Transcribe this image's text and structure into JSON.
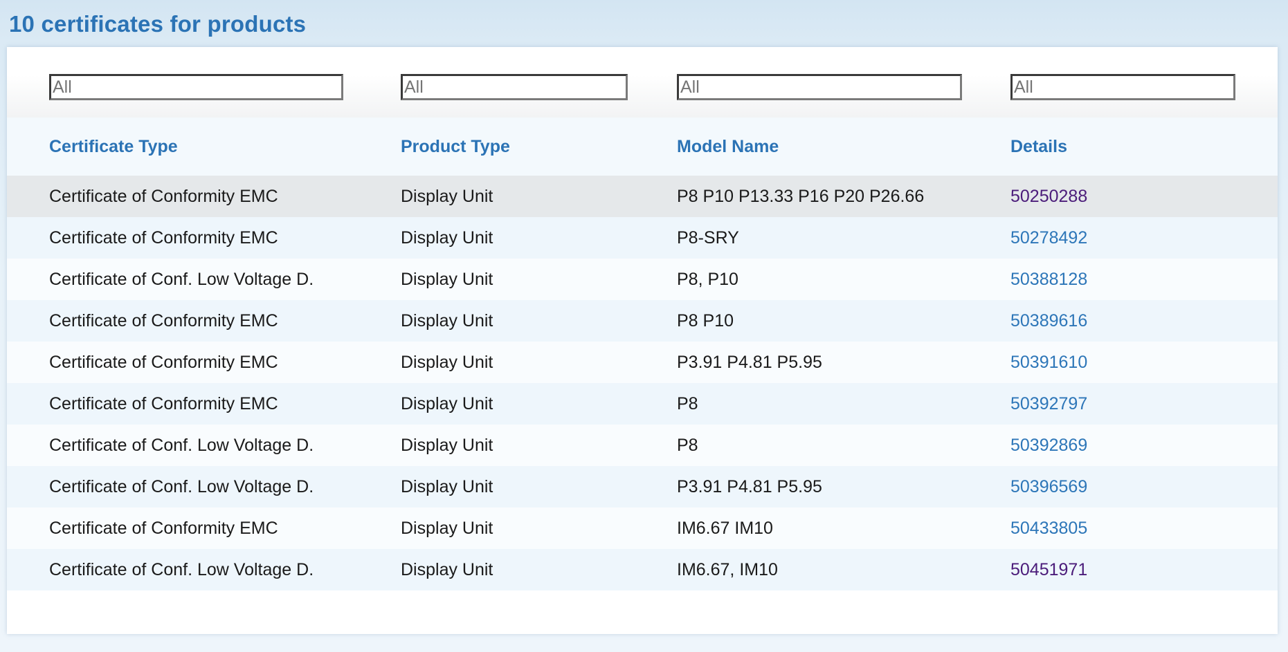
{
  "page": {
    "title": "10 certificates for products"
  },
  "filters": [
    {
      "placeholder": "All",
      "value": ""
    },
    {
      "placeholder": "All",
      "value": ""
    },
    {
      "placeholder": "All",
      "value": ""
    },
    {
      "placeholder": "All",
      "value": ""
    }
  ],
  "table": {
    "headers": [
      "Certificate Type",
      "Product Type",
      "Model Name",
      "Details"
    ],
    "rows": [
      {
        "certificate_type": "Certificate of Conformity EMC",
        "product_type": "Display Unit",
        "model_name": "P8 P10 P13.33 P16 P20 P26.66",
        "details": "50250288",
        "visited": true
      },
      {
        "certificate_type": "Certificate of Conformity EMC",
        "product_type": "Display Unit",
        "model_name": "P8-SRY",
        "details": "50278492",
        "visited": false
      },
      {
        "certificate_type": "Certificate of Conf. Low Voltage D.",
        "product_type": "Display Unit",
        "model_name": "P8, P10",
        "details": "50388128",
        "visited": false
      },
      {
        "certificate_type": "Certificate of Conformity EMC",
        "product_type": "Display Unit",
        "model_name": "P8 P10",
        "details": "50389616",
        "visited": false
      },
      {
        "certificate_type": "Certificate of Conformity EMC",
        "product_type": "Display Unit",
        "model_name": "P3.91 P4.81 P5.95",
        "details": "50391610",
        "visited": false
      },
      {
        "certificate_type": "Certificate of Conformity EMC",
        "product_type": "Display Unit",
        "model_name": "P8",
        "details": "50392797",
        "visited": false
      },
      {
        "certificate_type": "Certificate of Conf. Low Voltage D.",
        "product_type": "Display Unit",
        "model_name": "P8",
        "details": "50392869",
        "visited": false
      },
      {
        "certificate_type": "Certificate of Conf. Low Voltage D.",
        "product_type": "Display Unit",
        "model_name": "P3.91 P4.81 P5.95",
        "details": "50396569",
        "visited": false
      },
      {
        "certificate_type": "Certificate of Conformity EMC",
        "product_type": "Display Unit",
        "model_name": "IM6.67 IM10",
        "details": "50433805",
        "visited": false
      },
      {
        "certificate_type": "Certificate of Conf. Low Voltage D.",
        "product_type": "Display Unit",
        "model_name": "IM6.67, IM10",
        "details": "50451971",
        "visited": true
      }
    ]
  },
  "colors": {
    "accent": "#2b73b5",
    "link": "#2d76b8",
    "link_visited": "#4b1c7a",
    "row_highlight": "#e5e8ea"
  }
}
